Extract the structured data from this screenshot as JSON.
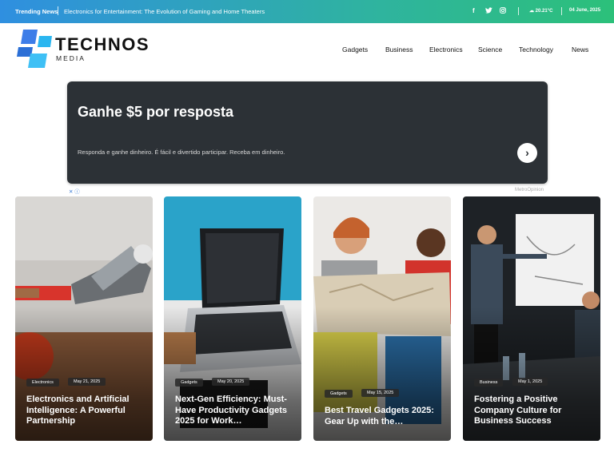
{
  "topbar": {
    "trending_label": "Trending News",
    "headline": "Electronics for Entertainment: The Evolution of Gaming and Home Theaters",
    "social": [
      "facebook-icon",
      "twitter-icon",
      "instagram-icon"
    ],
    "weather": "20.21°C",
    "date": "04 June, 2025"
  },
  "header": {
    "logo_text": "TECHNOS",
    "logo_sub": "MEDIA",
    "nav": [
      "Gadgets",
      "Business",
      "Electronics",
      "Science",
      "Technology",
      "News"
    ]
  },
  "ad": {
    "title": "Ganhe $5 por resposta",
    "description": "Responda e ganhe dinheiro. É fácil e divertido participar. Receba em dinheiro.",
    "button_icon": "chevron-right-icon",
    "close_label": "✕ ⓘ",
    "source": "MetroOpinion"
  },
  "cards": [
    {
      "tag": "Electronics",
      "date": "May 21, 2025",
      "title": "Electronics and Artificial Intelligence: A Powerful Partnership"
    },
    {
      "tag": "Gadgets",
      "date": "May 20, 2025",
      "title": "Next-Gen Efficiency: Must-Have Productivity Gadgets 2025 for Work…"
    },
    {
      "tag": "Gadgets",
      "date": "May 15, 2025",
      "title": "Best Travel Gadgets 2025: Gear Up with the…"
    },
    {
      "tag": "Business",
      "date": "May 1, 2025",
      "title": "Fostering a Positive Company Culture for Business Success"
    }
  ],
  "colors": {
    "topbar_start": "#2f8fe0",
    "topbar_end": "#2cc07a",
    "logo_blue": "#3d7de8",
    "logo_cyan": "#2ab6f0",
    "ad_bg": "#2c3136"
  }
}
